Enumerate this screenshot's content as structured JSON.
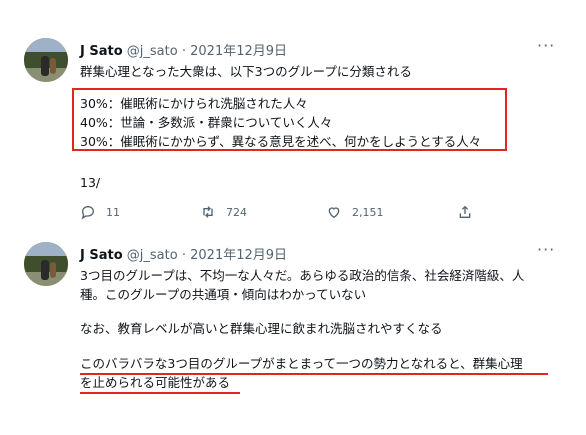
{
  "tweets": [
    {
      "name": "J Sato",
      "handle": "@j_sato",
      "separator": "·",
      "date": "2021年12月9日",
      "more": "···",
      "intro": "群集心理となった大衆は、以下3つのグループに分類される",
      "highlighted_lines": [
        "30%：催眠術にかけられ洗脳された人々",
        "40%：世論・多数派・群衆についていく人々",
        "30%：催眠術にかからず、異なる意見を述べ、何かをしようとする人々"
      ],
      "page": "13/",
      "replies": "11",
      "retweets": "724",
      "likes": "2,151"
    },
    {
      "name": "J Sato",
      "handle": "@j_sato",
      "separator": "·",
      "date": "2021年12月9日",
      "more": "···",
      "lines": [
        "3つ目のグループは、不均一な人々だ。あらゆる政治的信条、社会経済階級、人",
        "種。このグループの共通項・傾向はわかっていない",
        "なお、教育レベルが高いと群集心理に飲まれ洗脳されやすくなる",
        "このバラバラな3つ目のグループがまとまって一つの勢力となれると、群集心理",
        "を止められる可能性がある"
      ]
    }
  ],
  "colors": {
    "highlight": "#e0261f",
    "secondary_text": "#536471"
  },
  "icons": [
    "reply-icon",
    "retweet-icon",
    "like-icon",
    "share-icon",
    "more-icon"
  ]
}
